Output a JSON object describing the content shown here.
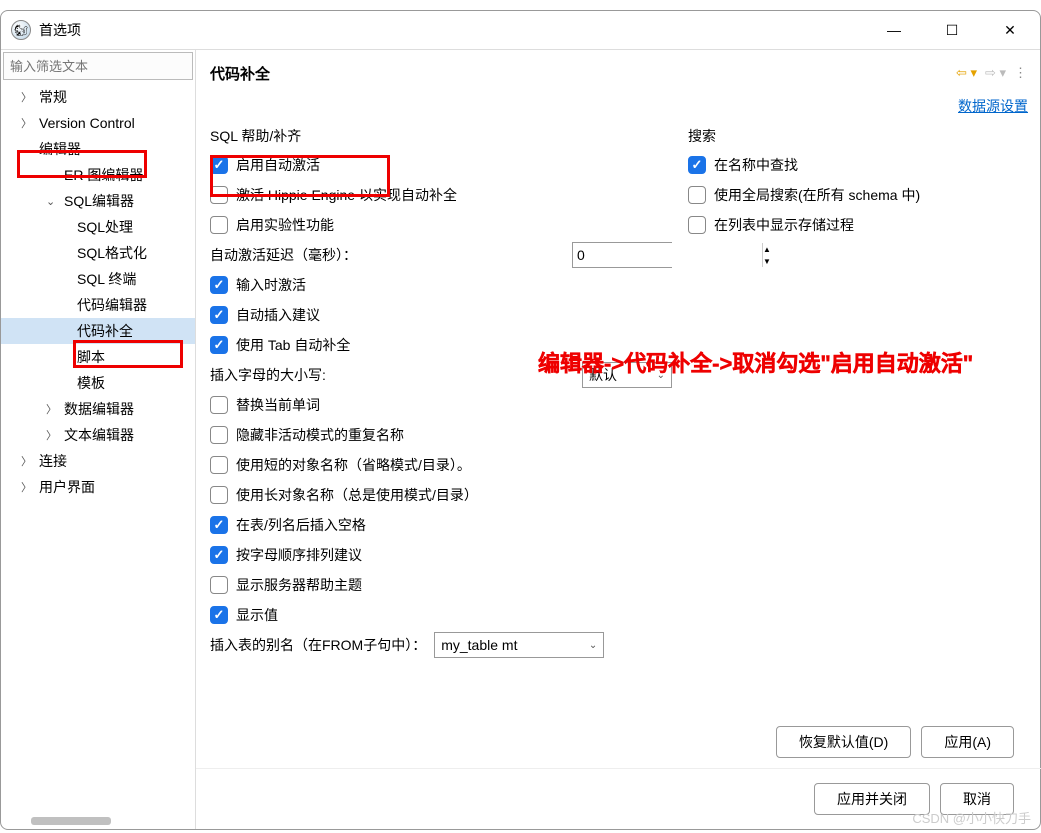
{
  "window": {
    "title": "首选项"
  },
  "sidebar": {
    "filter_placeholder": "输入筛选文本",
    "items": {
      "general": "常规",
      "version_control": "Version Control",
      "editor": "编辑器",
      "er": "ER 图编辑器",
      "sql_editor": "SQL编辑器",
      "sql_process": "SQL处理",
      "sql_format": "SQL格式化",
      "sql_terminal": "SQL 终端",
      "code_editor": "代码编辑器",
      "code_complete": "代码补全",
      "script": "脚本",
      "template": "模板",
      "data_editor": "数据编辑器",
      "text_editor": "文本编辑器",
      "connection": "连接",
      "ui": "用户界面"
    }
  },
  "main": {
    "title": "代码补全",
    "datasource_link": "数据源设置",
    "section_sql": "SQL 帮助/补齐",
    "enable_auto": "启用自动激活",
    "hippie": "激活 Hippie Engine 以实现自动补全",
    "experimental": "启用实验性功能",
    "delay_label": "自动激活延迟（毫秒）：",
    "delay_value": "0",
    "activate_typing": "输入时激活",
    "auto_insert": "自动插入建议",
    "use_tab": "使用 Tab 自动补全",
    "case_label": "插入字母的大小写:",
    "case_value": "默认",
    "replace_word": "替换当前单词",
    "hide_dup": "隐藏非活动模式的重复名称",
    "short_names": "使用短的对象名称（省略模式/目录）。",
    "long_names": "使用长对象名称（总是使用模式/目录）",
    "space_after": "在表/列名后插入空格",
    "sort_alpha": "按字母顺序排列建议",
    "show_server": "显示服务器帮助主题",
    "show_value": "显示值",
    "alias_label": "插入表的别名（在FROM子句中）：",
    "alias_value": "my_table mt",
    "search_title": "搜索",
    "search_name": "在名称中查找",
    "search_global": "使用全局搜索(在所有 schema 中)",
    "search_proc": "在列表中显示存储过程"
  },
  "buttons": {
    "restore": "恢复默认值(D)",
    "apply": "应用(A)",
    "apply_close": "应用并关闭",
    "cancel": "取消"
  },
  "annotation": "编辑器->代码补全->取消勾选\"启用自动激活\"",
  "watermark": "CSDN @小小快刀手"
}
